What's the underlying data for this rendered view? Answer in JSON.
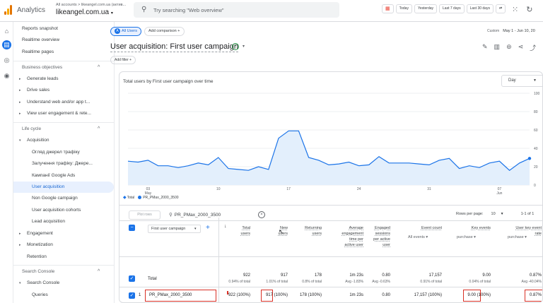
{
  "header": {
    "app_title": "Analytics",
    "account_crumb": "All accounts > likeangel.com.ua (актив...",
    "account_name": "likeangel.com.ua",
    "search_placeholder": "Try searching \"Web overview\"",
    "date_chips": [
      "Today",
      "Yesterday",
      "Last 7 days",
      "Last 30 days"
    ]
  },
  "sidebar": {
    "items": [
      {
        "label": "Reports snapshot"
      },
      {
        "label": "Realtime overview"
      },
      {
        "label": "Realtime pages"
      },
      {
        "label": "Business objectives"
      },
      {
        "label": "Generate leads"
      },
      {
        "label": "Drive sales"
      },
      {
        "label": "Understand web and/or app t..."
      },
      {
        "label": "View user engagement & rete..."
      },
      {
        "label": "Life cycle"
      },
      {
        "label": "Acquisition"
      },
      {
        "label": "Огляд джерел трафіку"
      },
      {
        "label": "Залучення трафіку: Джере..."
      },
      {
        "label": "Кампанії Google Ads"
      },
      {
        "label": "User acquisition"
      },
      {
        "label": "Non Google campaign"
      },
      {
        "label": "User acquisition cohorts"
      },
      {
        "label": "Lead acquisition"
      },
      {
        "label": "Engagement"
      },
      {
        "label": "Monetization"
      },
      {
        "label": "Retention"
      },
      {
        "label": "Search Console"
      },
      {
        "label": "Search Console"
      },
      {
        "label": "Queries"
      }
    ]
  },
  "main": {
    "segment_all": "All Users",
    "segment_all_badge": "A",
    "add_comparison": "Add comparison",
    "date_label": "Custom",
    "date_range": "May 1 - Jun 10, 20",
    "page_title": "User acquisition: First user campaign",
    "add_filter": "Add filter"
  },
  "chart_data": {
    "type": "line",
    "title": "Total users by First user campaign over time",
    "granularity": "Day",
    "x_tick_labels": [
      "03 May",
      "10",
      "17",
      "24",
      "31",
      "07 Jun"
    ],
    "y_tick_labels": [
      "100",
      "80",
      "60",
      "40",
      "20",
      "0"
    ],
    "ylim": [
      0,
      100
    ],
    "x": [
      "May 1",
      "May 2",
      "May 3",
      "May 4",
      "May 5",
      "May 6",
      "May 7",
      "May 8",
      "May 9",
      "May 10",
      "May 11",
      "May 12",
      "May 13",
      "May 14",
      "May 15",
      "May 16",
      "May 17",
      "May 18",
      "May 19",
      "May 20",
      "May 21",
      "May 22",
      "May 23",
      "May 24",
      "May 25",
      "May 26",
      "May 27",
      "May 28",
      "May 29",
      "May 30",
      "May 31",
      "Jun 1",
      "Jun 2",
      "Jun 3",
      "Jun 4",
      "Jun 5",
      "Jun 6",
      "Jun 7",
      "Jun 8",
      "Jun 9",
      "Jun 10"
    ],
    "series": [
      {
        "name": "PR_PMax_2000_3500",
        "values": [
          26,
          25,
          27,
          21,
          21,
          19,
          21,
          24,
          22,
          30,
          18,
          17,
          16,
          20,
          17,
          51,
          59,
          59,
          30,
          27,
          22,
          23,
          25,
          21,
          22,
          31,
          24,
          24,
          24,
          23,
          22,
          27,
          29,
          18,
          21,
          19,
          24,
          26,
          16,
          24,
          29
        ]
      }
    ],
    "legend": [
      "Total",
      "PR_PMax_2000_3500"
    ]
  },
  "table": {
    "plot_rows": "Plot rows",
    "search_value": "PR_PMax_2000_3500",
    "rows_per_page_label": "Rows per page:",
    "rows_per_page": "10",
    "page_range": "1-1 of 1",
    "dimension": "First user campaign",
    "columns": [
      {
        "h1": "Total",
        "h2": "users",
        "h3": "",
        "h4": "",
        "sub": ""
      },
      {
        "h1": "New",
        "h2": "users",
        "h3": "",
        "h4": "",
        "sub": ""
      },
      {
        "h1": "Returning",
        "h2": "users",
        "h3": "",
        "h4": "",
        "sub": ""
      },
      {
        "h1": "Average",
        "h2": "engagement",
        "h3": "time per",
        "h4": "active user",
        "sub": ""
      },
      {
        "h1": "Engaged",
        "h2": "sessions",
        "h3": "per active",
        "h4": "user",
        "sub": ""
      },
      {
        "h1": "Event count",
        "h2": "",
        "h3": "",
        "h4": "",
        "sub": "All events"
      },
      {
        "h1": "Key events",
        "h2": "",
        "h3": "",
        "h4": "",
        "sub": "purchase"
      },
      {
        "h1": "User key event",
        "h2": "rate",
        "h3": "",
        "h4": "",
        "sub": "purchase"
      }
    ],
    "totals_label": "Total",
    "totals": [
      {
        "v": "922",
        "s": "0.94% of total"
      },
      {
        "v": "917",
        "s": "1.01% of total"
      },
      {
        "v": "178",
        "s": "0.8% of total"
      },
      {
        "v": "1m 23s",
        "s": "Avg -1.83%"
      },
      {
        "v": "0.80",
        "s": "Avg -0.63%"
      },
      {
        "v": "17,157",
        "s": "0.91% of total"
      },
      {
        "v": "9.00",
        "s": "0.04% of total"
      },
      {
        "v": "0.87%",
        "s": "Avg -40.04%"
      }
    ],
    "row": {
      "index": "1",
      "name": "PR_PMax_2000_3500",
      "values": [
        "922 (100%)",
        "917 (100%)",
        "178 (100%)",
        "1m 23s",
        "0.80",
        "17,157 (100%)",
        "9.00 (100%)",
        "0.87%"
      ]
    }
  },
  "colors": {
    "accent": "#1a73e8",
    "line": "#1a73e8",
    "area": "#e3effc",
    "highlight": "#d93025"
  }
}
